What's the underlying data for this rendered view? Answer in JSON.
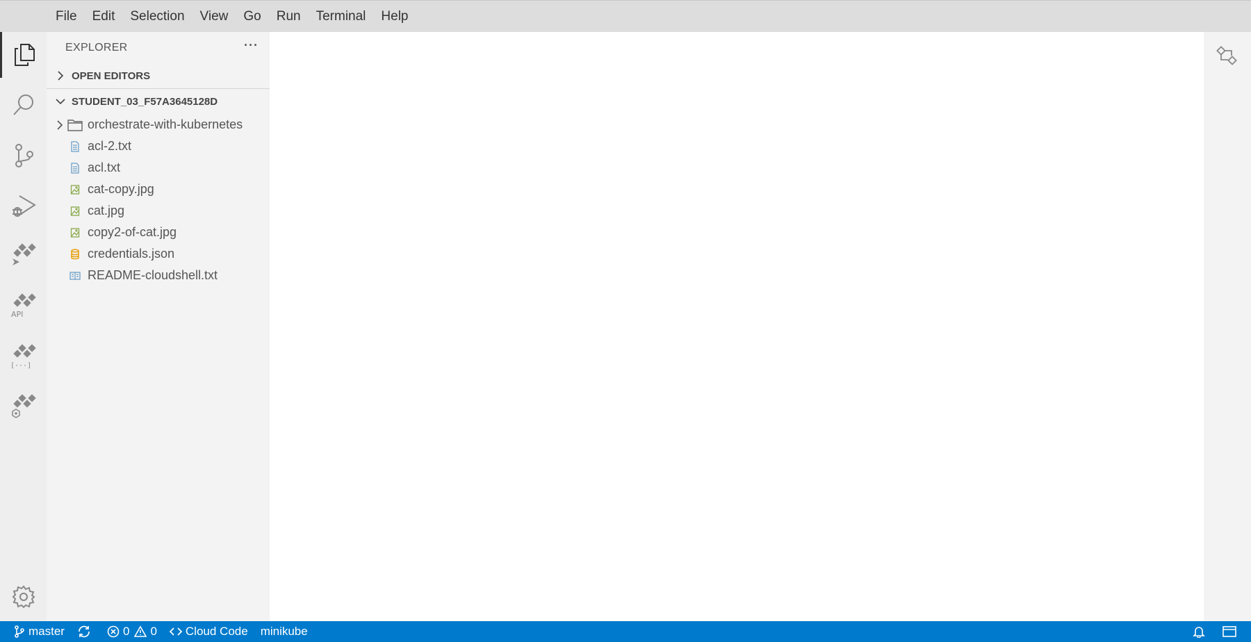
{
  "menu": [
    "File",
    "Edit",
    "Selection",
    "View",
    "Go",
    "Run",
    "Terminal",
    "Help"
  ],
  "activity_bar": {
    "items": [
      {
        "icon": "files-icon",
        "active": true
      },
      {
        "icon": "search-icon"
      },
      {
        "icon": "source-control-icon"
      },
      {
        "icon": "run-debug-icon"
      },
      {
        "icon": "cloud-code-run-icon"
      },
      {
        "icon": "cloud-code-api-icon"
      },
      {
        "icon": "cloud-code-secrets-icon"
      },
      {
        "icon": "cloud-code-kubernetes-icon"
      }
    ],
    "settings_icon": "gear-icon"
  },
  "sidebar": {
    "title": "EXPLORER",
    "more": "···",
    "open_editors": "OPEN EDITORS",
    "workspace": "STUDENT_03_F57A3645128D",
    "tree": [
      {
        "label": "orchestrate-with-kubernetes",
        "type": "folder",
        "icon": "folder-icon"
      },
      {
        "label": "acl-2.txt",
        "type": "file",
        "icon": "text-file-icon"
      },
      {
        "label": "acl.txt",
        "type": "file",
        "icon": "text-file-icon"
      },
      {
        "label": "cat-copy.jpg",
        "type": "file",
        "icon": "image-file-icon"
      },
      {
        "label": "cat.jpg",
        "type": "file",
        "icon": "image-file-icon"
      },
      {
        "label": "copy2-of-cat.jpg",
        "type": "file",
        "icon": "image-file-icon"
      },
      {
        "label": "credentials.json",
        "type": "file",
        "icon": "json-file-icon"
      },
      {
        "label": "README-cloudshell.txt",
        "type": "file",
        "icon": "readme-file-icon"
      }
    ]
  },
  "statusbar": {
    "branch": "master",
    "errors": "0",
    "warnings": "0",
    "cloud_code": "Cloud Code",
    "context": "minikube"
  },
  "colors": {
    "status_bar": "#007acc",
    "menubar": "#dddddd",
    "activity_bar": "#eeeeee",
    "sidebar": "#f3f3f3",
    "text_file": "#6c9ec8",
    "image_file": "#8aa94a",
    "json_file": "#e8a317"
  }
}
